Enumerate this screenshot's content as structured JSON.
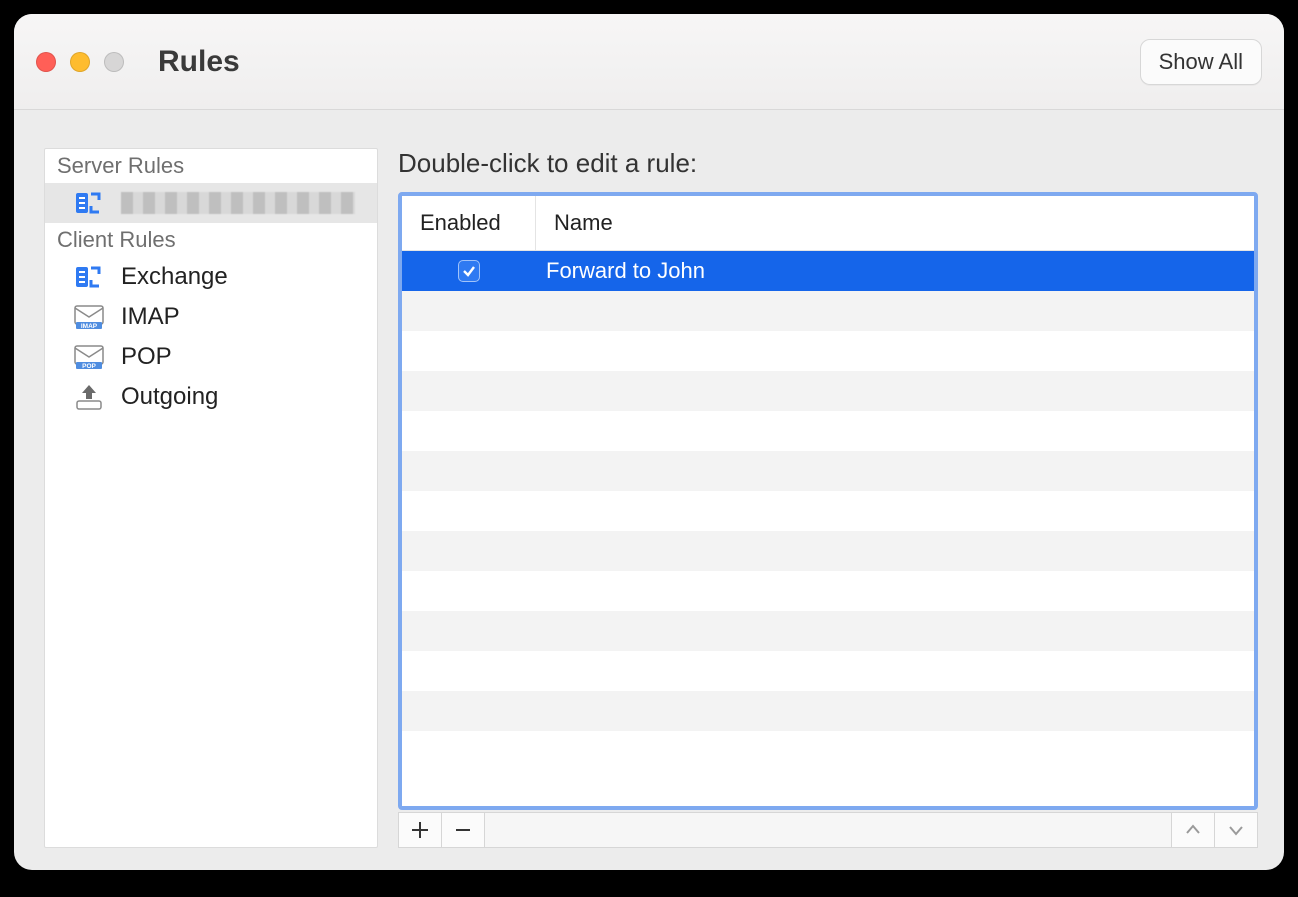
{
  "window": {
    "title": "Rules",
    "show_all": "Show All"
  },
  "sidebar": {
    "server_header": "Server Rules",
    "server_account_visible": false,
    "client_header": "Client Rules",
    "client_items": [
      {
        "label": "Exchange",
        "icon": "exchange-icon"
      },
      {
        "label": "IMAP",
        "icon": "imap-icon"
      },
      {
        "label": "POP",
        "icon": "pop-icon"
      },
      {
        "label": "Outgoing",
        "icon": "outgoing-icon"
      }
    ]
  },
  "main": {
    "instruction": "Double-click to edit a rule:",
    "columns": {
      "enabled": "Enabled",
      "name": "Name"
    },
    "rules": [
      {
        "enabled": true,
        "name": "Forward to John",
        "selected": true
      }
    ],
    "blank_rows": 12
  }
}
